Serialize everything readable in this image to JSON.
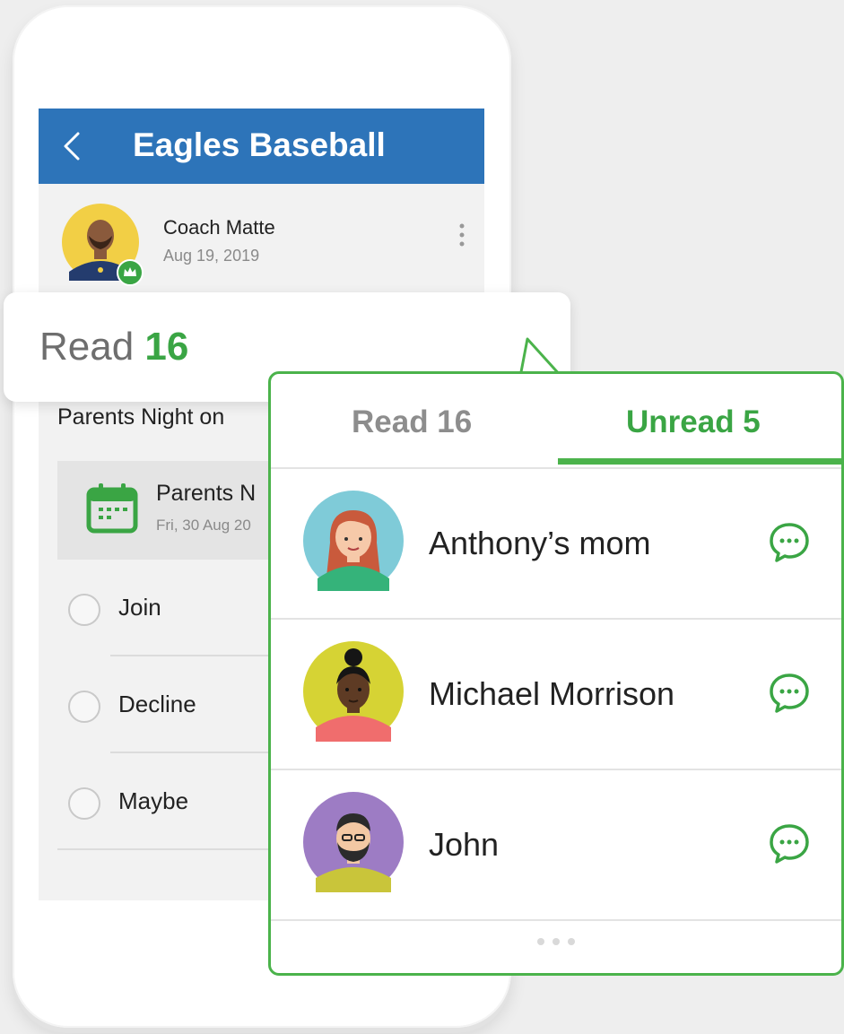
{
  "app_bar": {
    "title": "Eagles Baseball"
  },
  "post": {
    "author": "Coach Matte",
    "date": "Aug 19, 2019",
    "text": "Parents Night on",
    "event": {
      "title": "Parents N",
      "date": "Fri, 30 Aug 20"
    },
    "rsvp_options": [
      "Join",
      "Decline",
      "Maybe"
    ]
  },
  "read_badge": {
    "label": "Read",
    "count": "16"
  },
  "popup": {
    "tabs": {
      "read": "Read 16",
      "unread": "Unread 5"
    },
    "people": [
      {
        "name": "Anthony’s mom"
      },
      {
        "name": "Michael Morrison"
      },
      {
        "name": "John"
      }
    ]
  },
  "colors": {
    "brand_blue": "#2d74b9",
    "accent_green": "#3aa544"
  },
  "icons": [
    "chevron-left-icon",
    "more-vertical-icon",
    "calendar-icon",
    "chat-bubble-icon",
    "crown-badge-icon"
  ]
}
